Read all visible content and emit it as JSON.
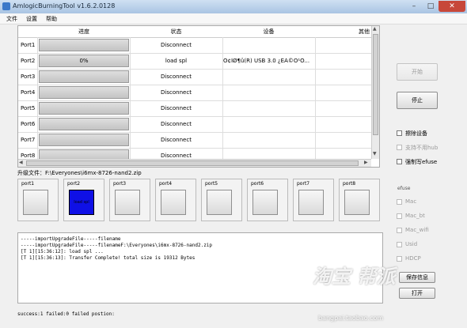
{
  "window": {
    "title": "AmlogicBurningTool  v1.6.2.0128",
    "minimize": "–",
    "maximize": "□",
    "close": "✕"
  },
  "menu": [
    "文件",
    "设置",
    "帮助"
  ],
  "grid": {
    "headers": [
      "进度",
      "状态",
      "设备",
      "其他"
    ],
    "rows": [
      {
        "port": "Port1",
        "progress_text": "",
        "progress_fraction": 0,
        "status": "Disconnect",
        "device": ""
      },
      {
        "port": "Port2",
        "progress_text": "0%",
        "progress_fraction": 0,
        "status": "load spl",
        "device": "Ó¢ÌØ¶û(R) USB 3.0 ¿ÉÀ©Õ¹Ö..."
      },
      {
        "port": "Port3",
        "progress_text": "",
        "progress_fraction": 0,
        "status": "Disconnect",
        "device": ""
      },
      {
        "port": "Port4",
        "progress_text": "",
        "progress_fraction": 0,
        "status": "Disconnect",
        "device": ""
      },
      {
        "port": "Port5",
        "progress_text": "",
        "progress_fraction": 0,
        "status": "Disconnect",
        "device": ""
      },
      {
        "port": "Port6",
        "progress_text": "",
        "progress_fraction": 0,
        "status": "Disconnect",
        "device": ""
      },
      {
        "port": "Port7",
        "progress_text": "",
        "progress_fraction": 0,
        "status": "Disconnect",
        "device": ""
      },
      {
        "port": "Port8",
        "progress_text": "",
        "progress_fraction": 0,
        "status": "Disconnect",
        "device": ""
      }
    ]
  },
  "upgrade_file_label": "升级文件：F:\\Everyones\\i6mx-8726-nand2.zip",
  "ports": [
    {
      "label": "port1",
      "active": false,
      "text": ""
    },
    {
      "label": "port2",
      "active": true,
      "text": "load spl"
    },
    {
      "label": "port3",
      "active": false,
      "text": ""
    },
    {
      "label": "port4",
      "active": false,
      "text": ""
    },
    {
      "label": "port5",
      "active": false,
      "text": ""
    },
    {
      "label": "port6",
      "active": false,
      "text": ""
    },
    {
      "label": "port7",
      "active": false,
      "text": ""
    },
    {
      "label": "port8",
      "active": false,
      "text": ""
    }
  ],
  "buttons": {
    "start": "开始",
    "stop": "停止",
    "save_info": "保存信息",
    "extra": "打开"
  },
  "options": {
    "erase_device": "擦除设备",
    "support_hub": "支持不用hub",
    "force_efuse": "强制写efuse"
  },
  "efuse": {
    "title": "efuse",
    "items": [
      "Mac",
      "Mac_bt",
      "Mac_wifi",
      "Usid",
      "HDCP"
    ]
  },
  "log_lines": [
    "-----importUpgradeFile-----filename",
    "-----importUpgradeFile-----filenameF:\\Everyones\\i6mx-8726-nand2.zip",
    "[T 1][15:36:12]: load spl ...",
    "[T 1][15:36:13]: Transfer Complete! total size is 19312 Bytes"
  ],
  "status_line": "success:1 failed:0 failed postion:",
  "watermark": {
    "text": "淘宝 帮派",
    "url": "bangpai.taobao.com"
  },
  "colors": {
    "active_port": "#0f10e6",
    "title_bar": "#a9c4e3"
  }
}
